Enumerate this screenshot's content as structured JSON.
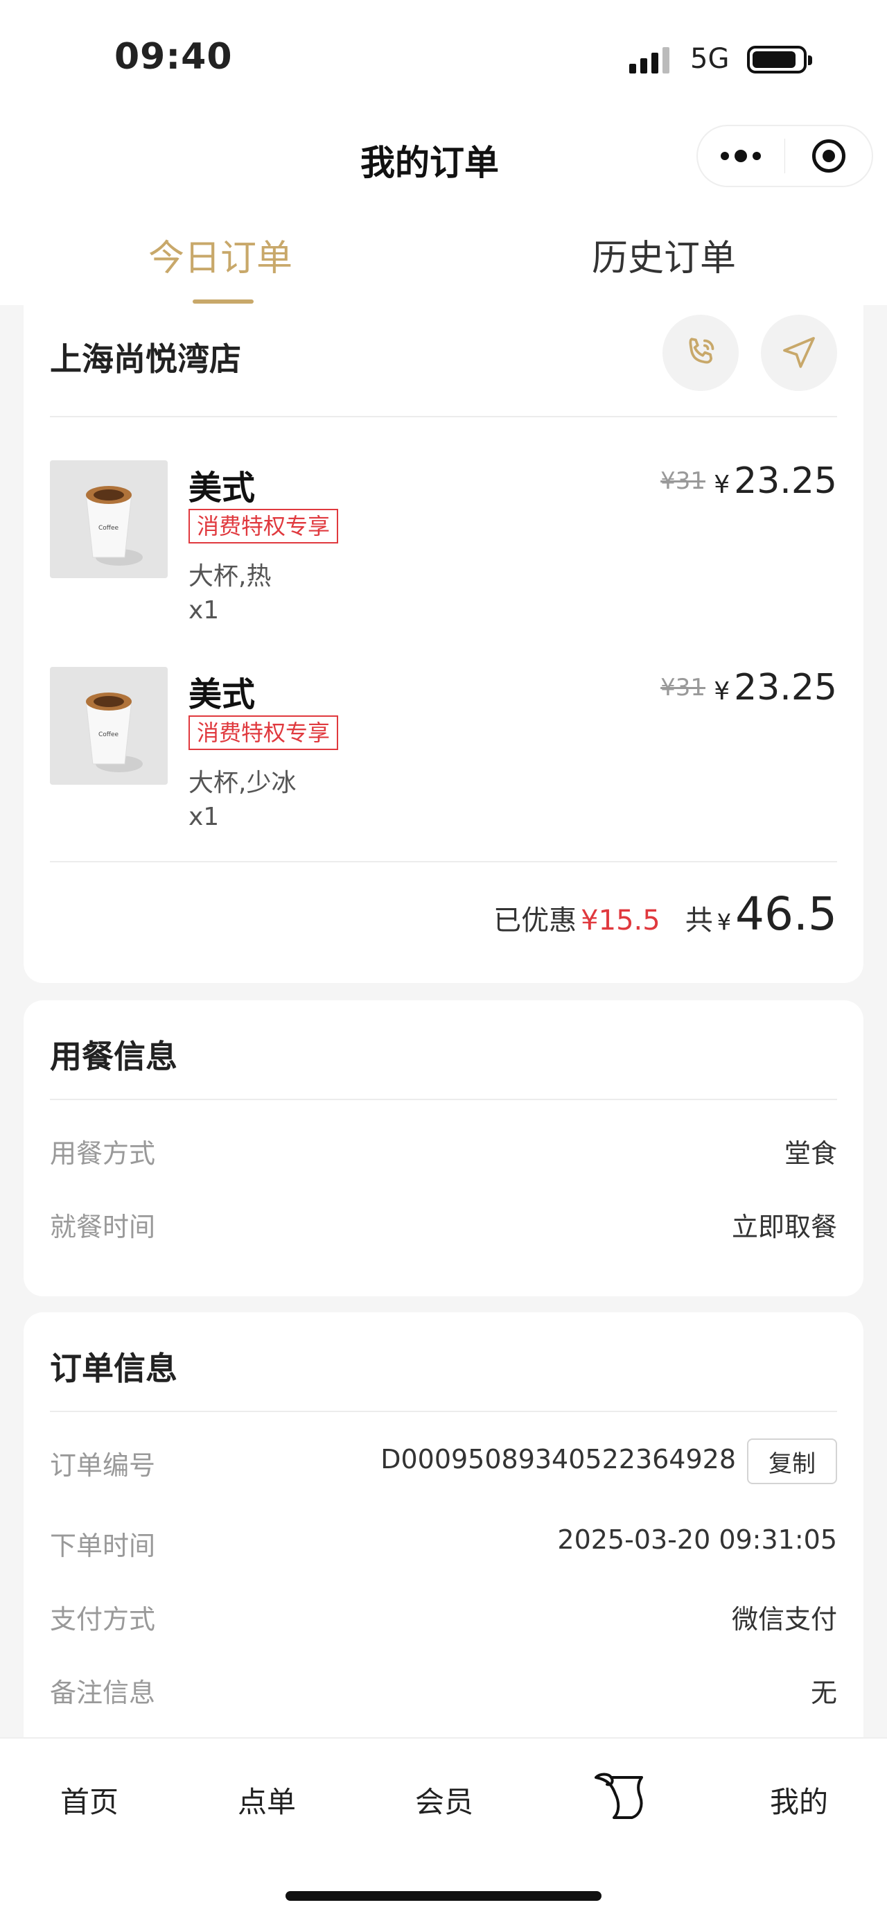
{
  "status_bar": {
    "time": "09:40",
    "network": "5G"
  },
  "header": {
    "title": "我的订单"
  },
  "tabs": [
    {
      "label": "今日订单",
      "active": true
    },
    {
      "label": "历史订单",
      "active": false
    }
  ],
  "store": {
    "name": "上海尚悦湾店"
  },
  "items": [
    {
      "name": "美式",
      "tag": "消费特权专享",
      "spec": "大杯,热",
      "qty": "x1",
      "orig_price": "¥31",
      "price_symbol": "¥",
      "price": "23.25"
    },
    {
      "name": "美式",
      "tag": "消费特权专享",
      "spec": "大杯,少冰",
      "qty": "x1",
      "orig_price": "¥31",
      "price_symbol": "¥",
      "price": "23.25"
    }
  ],
  "summary": {
    "discount_label": "已优惠",
    "discount_value": "¥15.5",
    "total_label": "共",
    "total_symbol": "¥",
    "total_value": "46.5"
  },
  "dining": {
    "title": "用餐信息",
    "rows": [
      {
        "label": "用餐方式",
        "value": "堂食"
      },
      {
        "label": "就餐时间",
        "value": "立即取餐"
      }
    ]
  },
  "order": {
    "title": "订单信息",
    "number_label": "订单编号",
    "number_value": "D00095089340522364928",
    "copy_label": "复制",
    "rows": [
      {
        "label": "下单时间",
        "value": "2025-03-20 09:31:05"
      },
      {
        "label": "支付方式",
        "value": "微信支付"
      },
      {
        "label": "备注信息",
        "value": "无"
      }
    ]
  },
  "tabbar": [
    {
      "label": "首页"
    },
    {
      "label": "点单"
    },
    {
      "label": "会员"
    },
    {
      "icon": "scroll-icon"
    },
    {
      "label": "我的"
    }
  ],
  "colors": {
    "accent": "#c8a86a",
    "promo": "#e0393e"
  }
}
